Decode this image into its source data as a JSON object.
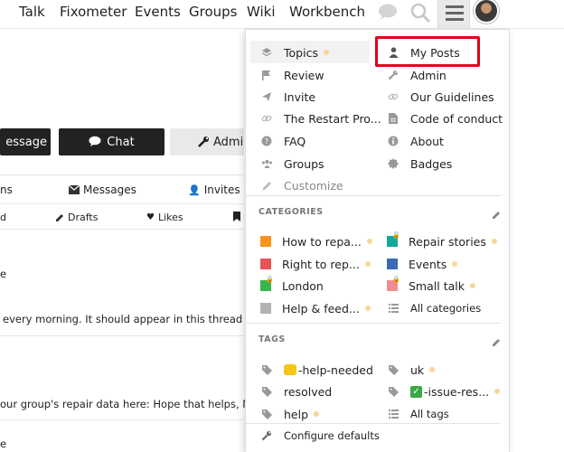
{
  "nav": {
    "links": [
      "Talk",
      "Fixometer",
      "Events",
      "Groups",
      "Wiki",
      "Workbench"
    ],
    "icons": [
      "chat-bubble-icon",
      "search-icon",
      "hamburger-menu-icon"
    ]
  },
  "background": {
    "buttons": {
      "message": "essage",
      "chat": "Chat",
      "admin": "Admi"
    },
    "tabs": {
      "notifications": "ns",
      "messages": "Messages",
      "invites": "Invites"
    },
    "subtabs": {
      "first": "d",
      "drafts": "Drafts",
      "likes": "Likes"
    },
    "posts": [
      "e",
      "every morning. It should appear in this thread so",
      "our group's repair data here: Hope that helps, Ne",
      "e"
    ]
  },
  "menu": {
    "left": [
      "Topics",
      "Review",
      "Invite",
      "The Restart Pro...",
      "FAQ",
      "Groups",
      "Customize"
    ],
    "right": [
      "My Posts",
      "Admin",
      "Our Guidelines",
      "Code of conduct",
      "About",
      "Badges"
    ],
    "categories_header": "CATEGORIES",
    "categories": [
      {
        "label": "How to repa...",
        "color": "#f7941d"
      },
      {
        "label": "Repair stories",
        "color": "#12a89d"
      },
      {
        "label": "Right to rep...",
        "color": "#e45459"
      },
      {
        "label": "Events",
        "color": "#3a6ab4"
      },
      {
        "label": "London",
        "color": "#3ab54a"
      },
      {
        "label": "Small talk",
        "color": "#f08c91"
      },
      {
        "label": "Help & feed...",
        "color": "#b3b3b3"
      },
      {
        "label": "All categories",
        "color": ""
      }
    ],
    "tags_header": "TAGS",
    "tags": [
      "-help-needed",
      "uk",
      "resolved",
      "-issue-res...",
      "help",
      "All tags"
    ],
    "configure": "Configure defaults"
  }
}
